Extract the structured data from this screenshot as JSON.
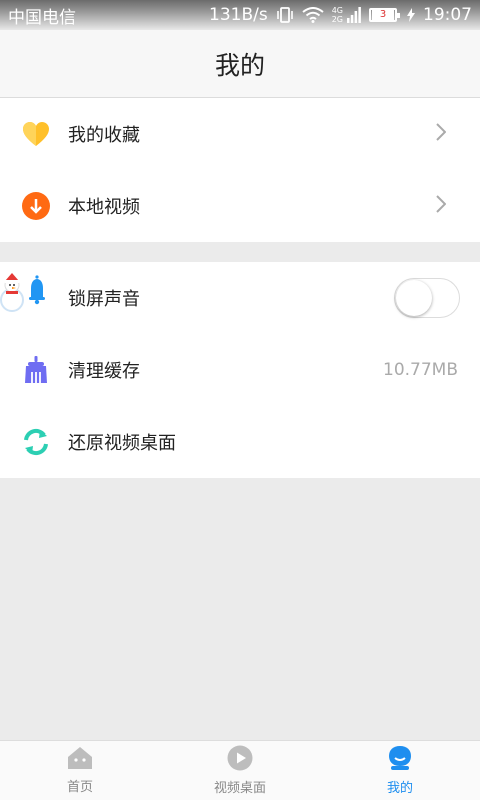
{
  "statusbar": {
    "carrier": "中国电信",
    "speed": "131B/s",
    "network_top": "4G",
    "network_bottom": "2G",
    "battery": "3",
    "time": "19:07"
  },
  "header": {
    "title": "我的"
  },
  "group1": [
    {
      "label": "我的收藏",
      "icon": "heart-icon"
    },
    {
      "label": "本地视频",
      "icon": "download-icon"
    }
  ],
  "group2": {
    "lock_sound": {
      "label": "锁屏声音",
      "toggle_on": false
    },
    "clear_cache": {
      "label": "清理缓存",
      "value": "10.77MB"
    },
    "restore_desktop": {
      "label": "还原视频桌面"
    }
  },
  "bottomnav": [
    {
      "label": "首页",
      "icon": "home-icon"
    },
    {
      "label": "视频桌面",
      "icon": "play-icon"
    },
    {
      "label": "我的",
      "icon": "profile-icon",
      "active": true
    }
  ],
  "colors": {
    "accent": "#1e8eef",
    "heart": "#ffc02a",
    "download": "#ff6a13",
    "broom": "#6f6df2",
    "refresh": "#2ccfb3"
  }
}
